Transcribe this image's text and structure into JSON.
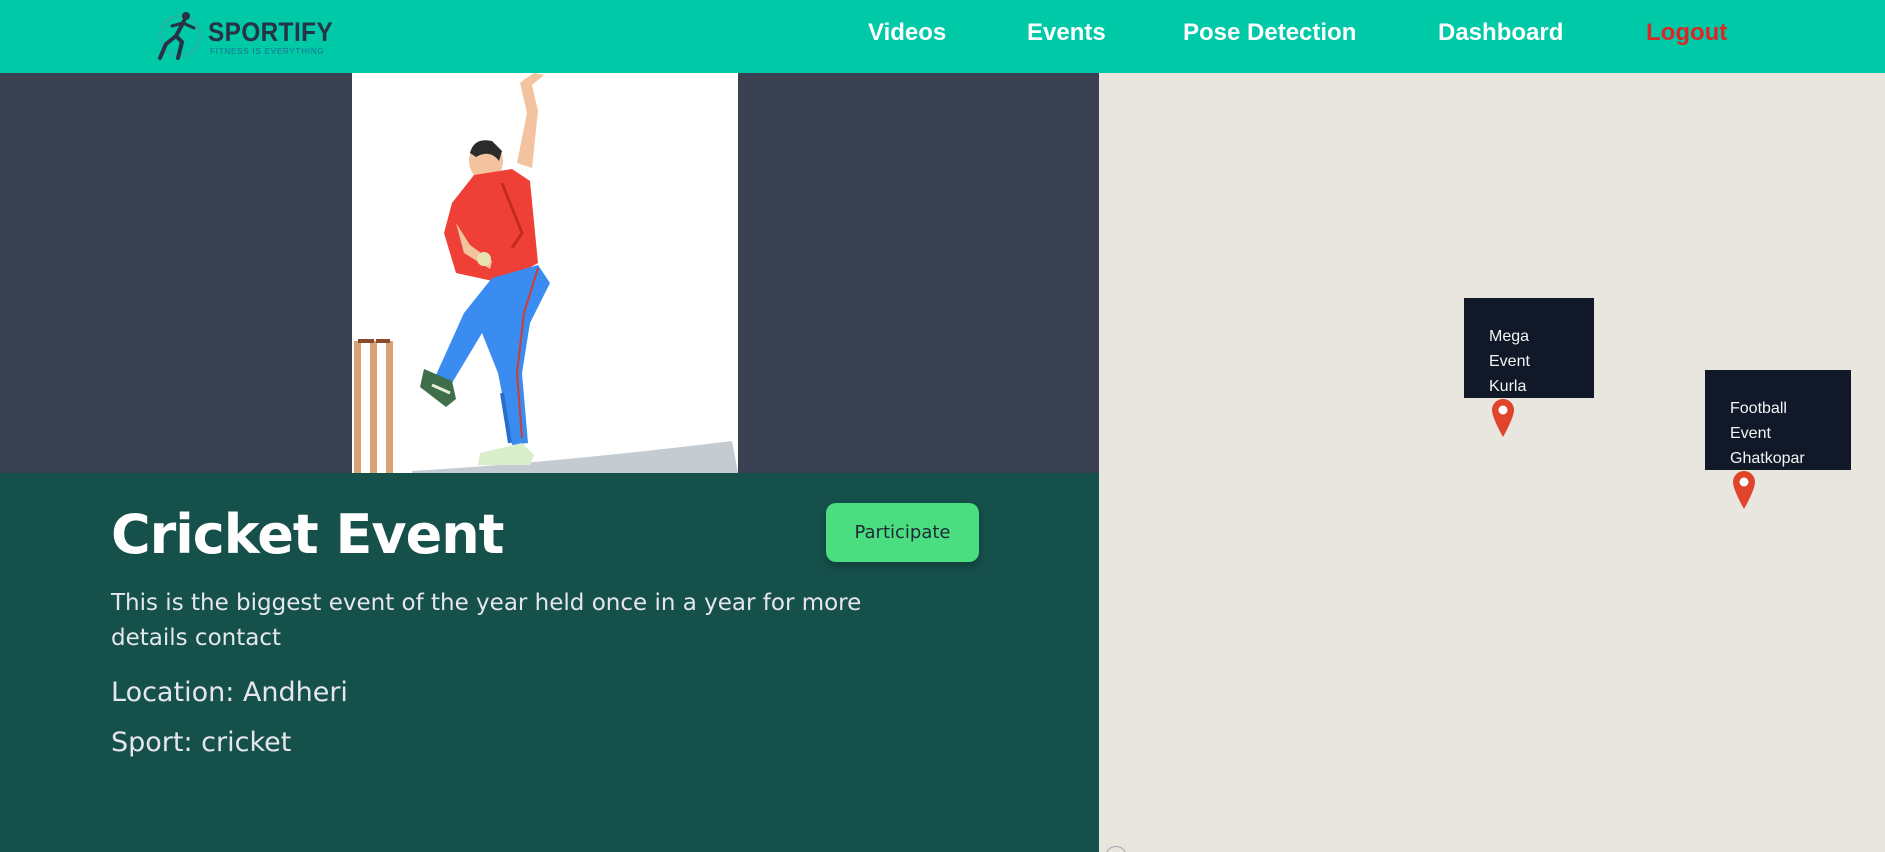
{
  "brand": {
    "name": "SPORTIFY",
    "tagline": "FITNESS IS EVERYTHING"
  },
  "nav": {
    "videos": "Videos",
    "events": "Events",
    "pose_detection": "Pose Detection",
    "dashboard": "Dashboard",
    "logout": "Logout"
  },
  "event": {
    "title": "Cricket Event",
    "participate_label": "Participate",
    "description": "This is the biggest event of the year held once in a year for more details contact",
    "location": "Location: Andheri",
    "sport": "Sport: cricket"
  },
  "map": {
    "markers": [
      {
        "line1": "Mega Event",
        "line2": "Kurla"
      },
      {
        "line1": "Football Event",
        "line2": "Ghatkopar"
      }
    ]
  },
  "colors": {
    "navbar": "#00c9a7",
    "hero_bg": "#394152",
    "details_bg": "#16504b",
    "participate": "#4ade80",
    "logout": "#dc2626",
    "popup_bg": "#111827",
    "pin": "#e0452c"
  },
  "icons": {
    "logo": "runner-icon",
    "marker": "map-pin-icon"
  }
}
